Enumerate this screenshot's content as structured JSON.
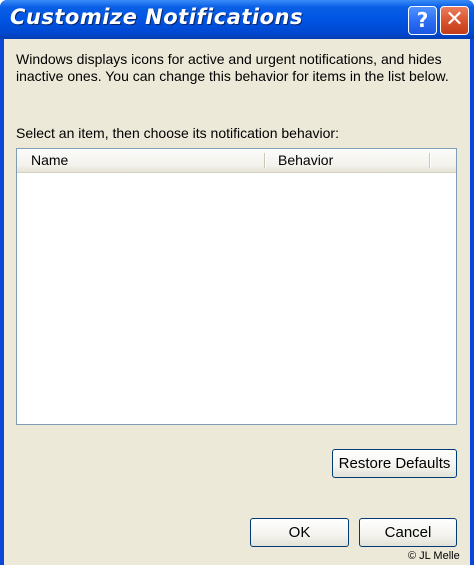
{
  "window": {
    "title": "Customize Notifications",
    "help_glyph": "?",
    "close_glyph": "✕"
  },
  "description": "Windows displays icons for active and urgent notifications, and hides inactive ones. You can change this behavior for items in the list below.",
  "select_label": "Select an item, then choose its notification behavior:",
  "list": {
    "columns": [
      "Name",
      "Behavior"
    ],
    "items": []
  },
  "buttons": {
    "restore_defaults": "Restore Defaults",
    "ok": "OK",
    "cancel": "Cancel"
  },
  "watermark": "© JL Melle",
  "colors": {
    "titlebar": "#0054e3",
    "dialog_face": "#ece9d8",
    "list_border": "#7f9db9",
    "button_border": "#003c74"
  }
}
